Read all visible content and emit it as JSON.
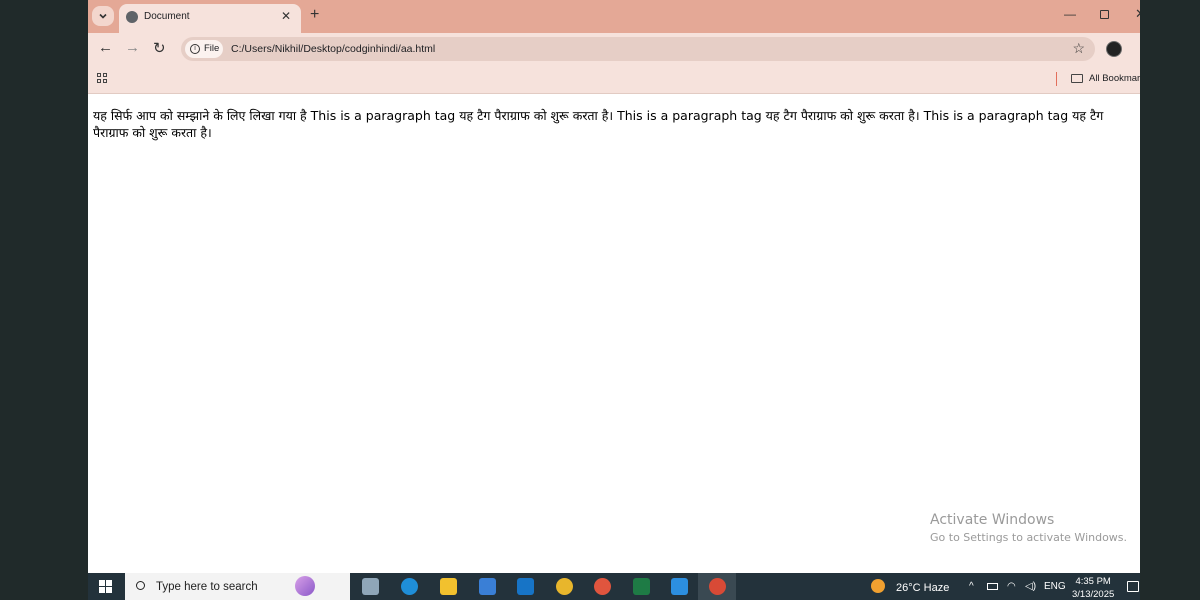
{
  "browser": {
    "tab_title": "Document",
    "close_glyph": "✕",
    "new_tab_glyph": "+",
    "minimize_glyph": "—",
    "window_close_glyph": "✕",
    "back_glyph": "←",
    "forward_glyph": "→",
    "reload_glyph": "↻",
    "file_chip_label": "File",
    "info_glyph": "i",
    "url": "C:/Users/Nikhil/Desktop/codginhindi/aa.html",
    "star_glyph": "☆",
    "bookmarks_label": "All Bookmarks"
  },
  "page": {
    "paragraph": "यह सिर्फ आप को सम्झाने के लिए लिखा गया है This is a paragraph tag यह टैग पैराग्राफ को शुरू करता है। This is a paragraph tag यह टैग पैराग्राफ को शुरू करता है। This is a paragraph tag यह टैग पैराग्राफ को शुरू करता है।"
  },
  "watermark": {
    "line1": "Activate Windows",
    "line2": "Go to Settings to activate Windows."
  },
  "taskbar": {
    "search_placeholder": "Type here to search",
    "weather": "26°C  Haze",
    "chevron_glyph": "^",
    "language": "ENG",
    "time": "4:35 PM",
    "date": "3/13/2025",
    "apps": [
      {
        "name": "task-view",
        "color": "#8fa6b8"
      },
      {
        "name": "edge",
        "color": "#1f8ed8"
      },
      {
        "name": "file-explorer",
        "color": "#f2c12e"
      },
      {
        "name": "store",
        "color": "#3a7fd6"
      },
      {
        "name": "outlook",
        "color": "#1774c6"
      },
      {
        "name": "chrome",
        "color": "#e8b62c"
      },
      {
        "name": "chrome-profile",
        "color": "#e0553e"
      },
      {
        "name": "excel",
        "color": "#1e7b45"
      },
      {
        "name": "vscode",
        "color": "#2c8fe0"
      },
      {
        "name": "chrome-active",
        "color": "#d84a36"
      }
    ]
  }
}
